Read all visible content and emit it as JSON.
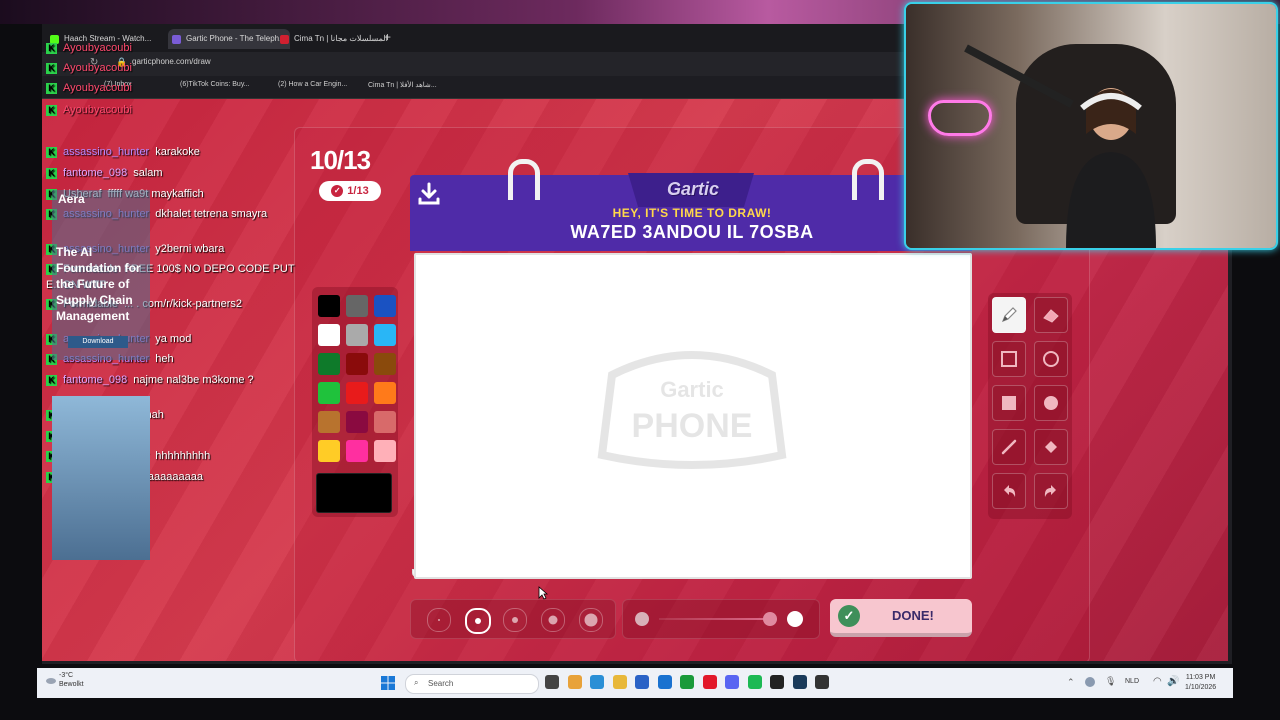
{
  "browser": {
    "tabs": [
      {
        "label": "Haach Stream - Watch...",
        "color": "#53fc18"
      },
      {
        "label": "Gartic Phone - The Teleph...",
        "color": "#7a5cd6"
      },
      {
        "label": "Cima Tn | المسلسلات مجانا",
        "color": "#d02030"
      }
    ],
    "url": "garticphone.com/draw",
    "bookmarks": [
      {
        "label": "(7) Inbox",
        "color": "#d33"
      },
      {
        "label": "(6)TikTok Coins: Buy...",
        "color": "#111"
      },
      {
        "label": "(2) How a Car Engin...",
        "color": "#e22"
      },
      {
        "label": "Cima Tn | شاهد الأفلا...",
        "color": "#d02030"
      }
    ]
  },
  "game": {
    "round": "10/13",
    "done_count": "1/13",
    "brand": "Gartic",
    "prompt_title": "HEY, IT'S TIME TO DRAW!",
    "prompt_word": "WA7ED 3ANDOU IL 7OSBA",
    "watermark_top": "Gartic",
    "watermark_bottom": "PHONE",
    "done_label": "DONE!",
    "palette": [
      "#000000",
      "#666666",
      "#1a52c2",
      "#ffffff",
      "#aaaaaa",
      "#29b6f6",
      "#0e7a2a",
      "#8a0b0b",
      "#8a4a0c",
      "#1fc23c",
      "#e81b1b",
      "#ff7a1a",
      "#b8732e",
      "#8a0a40",
      "#d86a6a",
      "#ffcc26",
      "#ff2fa0",
      "#ffb0b8"
    ],
    "current_color": "#000000",
    "selected_size_index": 1,
    "opacity_level": 1.0,
    "tools": [
      {
        "name": "pen-tool",
        "icon": "pen-icon"
      },
      {
        "name": "eraser-tool",
        "icon": "eraser-icon"
      },
      {
        "name": "rect-outline-tool",
        "icon": "square-outline-icon"
      },
      {
        "name": "ellipse-outline-tool",
        "icon": "circle-outline-icon"
      },
      {
        "name": "rect-fill-tool",
        "icon": "square-fill-icon"
      },
      {
        "name": "ellipse-fill-tool",
        "icon": "circle-fill-icon"
      },
      {
        "name": "line-tool",
        "icon": "line-icon"
      },
      {
        "name": "fill-bucket-tool",
        "icon": "bucket-icon"
      },
      {
        "name": "undo-tool",
        "icon": "undo-icon"
      },
      {
        "name": "redo-tool",
        "icon": "redo-icon"
      }
    ]
  },
  "chat": {
    "messages": [
      {
        "user": "Ayoubyacoubi",
        "text": "",
        "style": "red"
      },
      {
        "user": "Ayoubyacoubi",
        "text": "",
        "style": "red"
      },
      {
        "user": "Ayoubyacoubi",
        "text": "",
        "style": "red"
      },
      {
        "user": "Ayoubyacoubi",
        "text": "",
        "style": "red"
      },
      {
        "user": "assassino_hunter",
        "text": "karakoke",
        "style": "purple"
      },
      {
        "user": "fantome_098",
        "text": "salam",
        "style": "pink"
      },
      {
        "user": "Usheraf",
        "text": "fffff wa9t maykaffich",
        "style": "white"
      },
      {
        "user": "assassino_hunter",
        "text": "dkhalet tetrena smayra",
        "style": "purple"
      },
      {
        "user": "assassino_hunter",
        "text": "y2berni wbara",
        "style": "purple"
      },
      {
        "user": "Formidable",
        "text": "FREE 100$ NO DEPO CODE PUT E.. ON WTF",
        "style": "white"
      },
      {
        "user": "Formidable",
        "text": "... . com/r/kick-partners2",
        "style": "white"
      },
      {
        "user": "assassino_hunter",
        "text": "ya mod",
        "style": "purple"
      },
      {
        "user": "assassino_hunter",
        "text": "heh",
        "style": "purple"
      },
      {
        "user": "fantome_098",
        "text": "najme nal3be m3kome ?",
        "style": "pink"
      },
      {
        "user": "fantome_098",
        "text": "hahah",
        "style": "pink"
      },
      {
        "user": "Ayoubyacoubi",
        "text": "",
        "style": "red"
      },
      {
        "user": "assassino_hunter",
        "text": "hhhhhhhhh",
        "style": "purple"
      },
      {
        "user": "fantome_098",
        "text": "laaaaaaaaaaa",
        "style": "pink"
      }
    ],
    "ad": {
      "title": "Aera",
      "body": "The AI Foundation for the Future of Supply Chain Management",
      "button": "Download"
    }
  },
  "taskbar": {
    "weather_temp": "-3°C",
    "weather_desc": "Bewolkt",
    "search_placeholder": "Search",
    "language": "NLD",
    "time": "11:03 PM",
    "date": "1/10/2026",
    "apps": [
      {
        "name": "task-view",
        "color": "#444"
      },
      {
        "name": "chrome",
        "color": "#e8a23a"
      },
      {
        "name": "edge",
        "color": "#2a8fd6"
      },
      {
        "name": "explorer",
        "color": "#e8b83a"
      },
      {
        "name": "store",
        "color": "#2a62c6"
      },
      {
        "name": "outlook",
        "color": "#1a72d0"
      },
      {
        "name": "xbox",
        "color": "#1a9a3a"
      },
      {
        "name": "opera",
        "color": "#e2182a"
      },
      {
        "name": "discord",
        "color": "#5865f2"
      },
      {
        "name": "spotify",
        "color": "#1db954"
      },
      {
        "name": "obs",
        "color": "#222"
      },
      {
        "name": "steam",
        "color": "#1a3a5a"
      },
      {
        "name": "media",
        "color": "#333"
      }
    ]
  }
}
